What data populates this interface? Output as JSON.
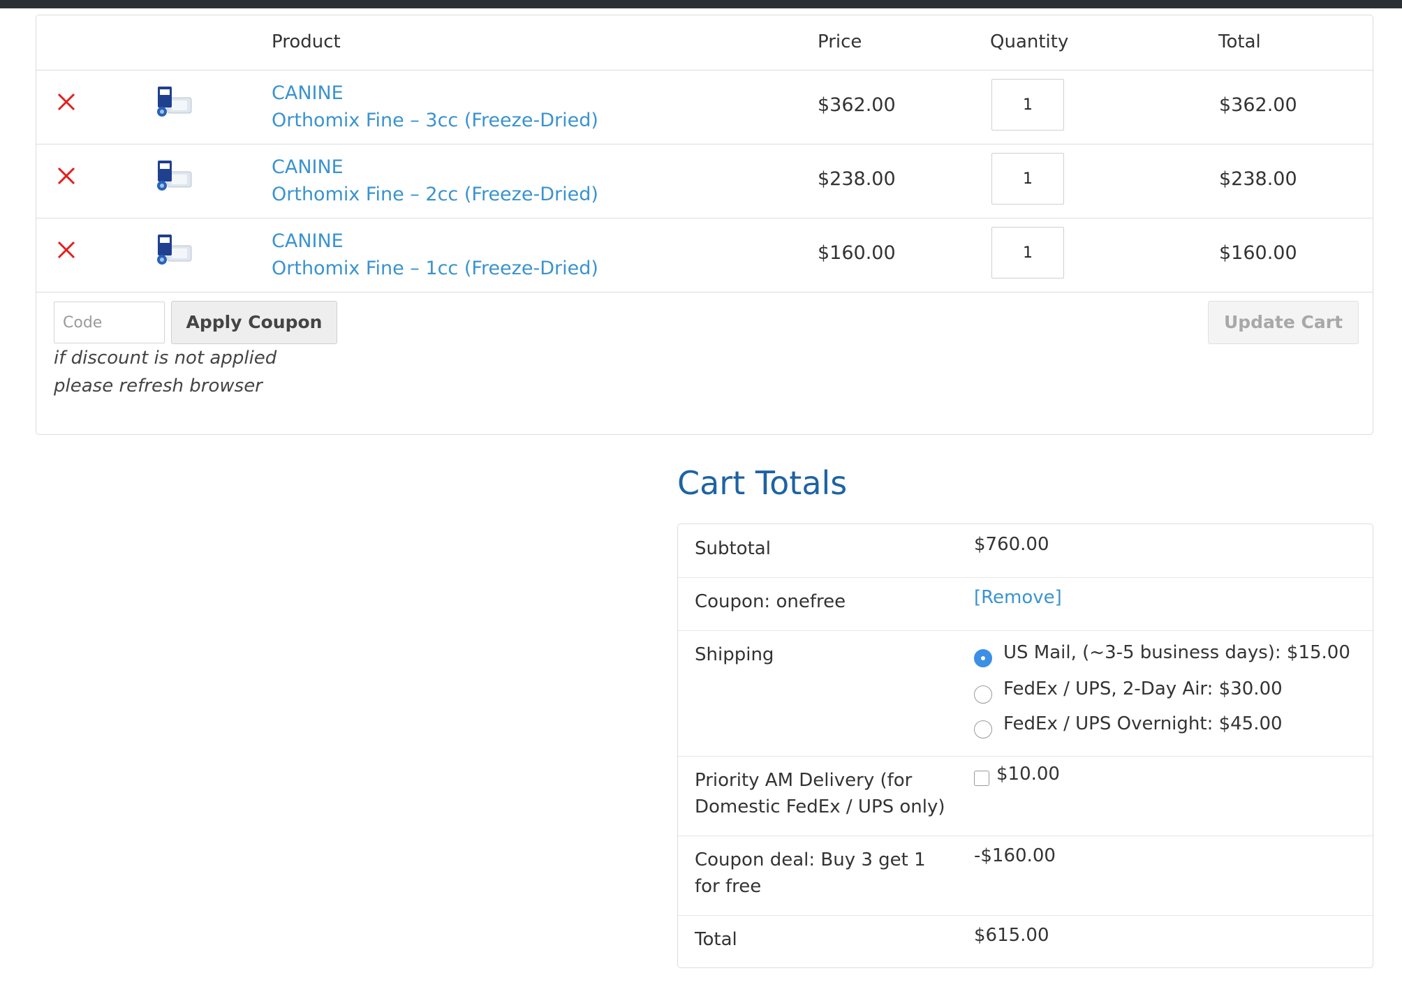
{
  "cart": {
    "headers": {
      "product": "Product",
      "price": "Price",
      "quantity": "Quantity",
      "total": "Total"
    },
    "rows": [
      {
        "category": "CANINE",
        "name": "Orthomix Fine – 3cc (Freeze-Dried)",
        "price": "$362.00",
        "quantity": "1",
        "total": "$362.00"
      },
      {
        "category": "CANINE",
        "name": "Orthomix Fine – 2cc (Freeze-Dried)",
        "price": "$238.00",
        "quantity": "1",
        "total": "$238.00"
      },
      {
        "category": "CANINE",
        "name": "Orthomix Fine – 1cc (Freeze-Dried)",
        "price": "$160.00",
        "quantity": "1",
        "total": "$160.00"
      }
    ],
    "coupon": {
      "placeholder": "Code",
      "apply_label": "Apply Coupon",
      "note_line1": "if discount is not applied",
      "note_line2": "please refresh browser"
    },
    "update_label": "Update Cart"
  },
  "totals": {
    "title": "Cart Totals",
    "subtotal_label": "Subtotal",
    "subtotal_value": "$760.00",
    "coupon_label": "Coupon: onefree",
    "coupon_remove": "[Remove]",
    "shipping_label": "Shipping",
    "shipping_options": [
      {
        "label": "US Mail, (~3-5 business days): $15.00",
        "selected": true
      },
      {
        "label": "FedEx / UPS, 2-Day Air: $30.00",
        "selected": false
      },
      {
        "label": "FedEx / UPS Overnight: $45.00",
        "selected": false
      }
    ],
    "priority_label_line1": "Priority AM Delivery (for",
    "priority_label_line2": "Domestic FedEx / UPS only)",
    "priority_value": "$10.00",
    "deal_label_line1": "Coupon deal: Buy 3 get 1",
    "deal_label_line2": "for free",
    "deal_value": "-$160.00",
    "total_label": "Total",
    "total_value": "$615.00"
  },
  "colors": {
    "link": "#3a93cf",
    "heading": "#1d63a3",
    "remove": "#e0201c",
    "radio_selected": "#3b8fe6"
  },
  "icons": {
    "remove": "close-x-icon",
    "product_image": "product-thumbnail"
  }
}
